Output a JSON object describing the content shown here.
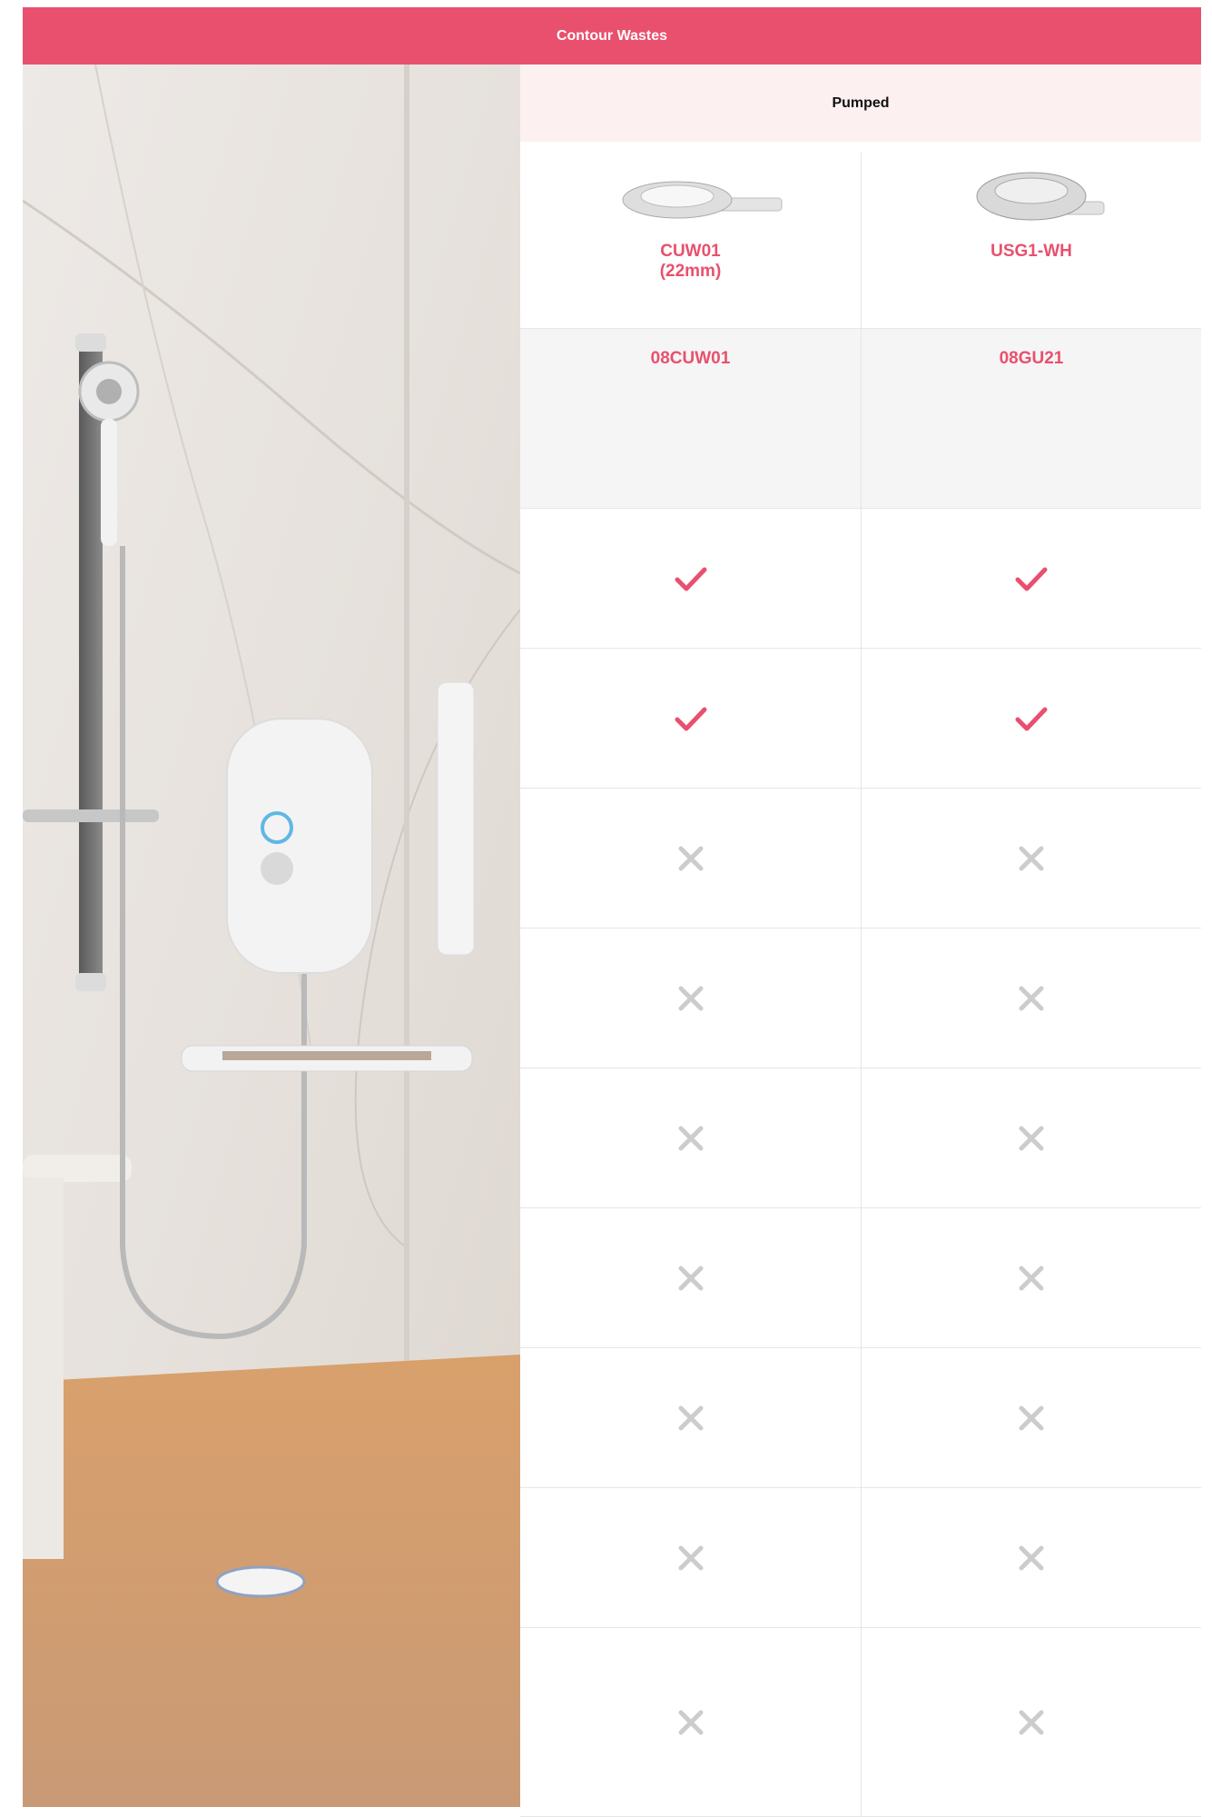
{
  "header": {
    "title": "Contour Wastes"
  },
  "subheader": {
    "title": "Pumped"
  },
  "colors": {
    "accent": "#e9506e",
    "cross": "#cccccc",
    "subheader_bg": "#fdf0f0",
    "code_bg": "#f5f5f5"
  },
  "products": [
    {
      "name": "CUW01\n(22mm)",
      "code": "08CUW01",
      "image": "round-waste-with-outlet-image"
    },
    {
      "name": "USG1-WH",
      "code": "08GU21",
      "image": "gully-waste-image"
    }
  ],
  "features": [
    [
      "check",
      "check"
    ],
    [
      "check",
      "check"
    ],
    [
      "cross",
      "cross"
    ],
    [
      "cross",
      "cross"
    ],
    [
      "cross",
      "cross"
    ],
    [
      "cross",
      "cross"
    ],
    [
      "cross",
      "cross"
    ],
    [
      "cross",
      "cross"
    ],
    [
      "cross",
      "cross"
    ]
  ]
}
